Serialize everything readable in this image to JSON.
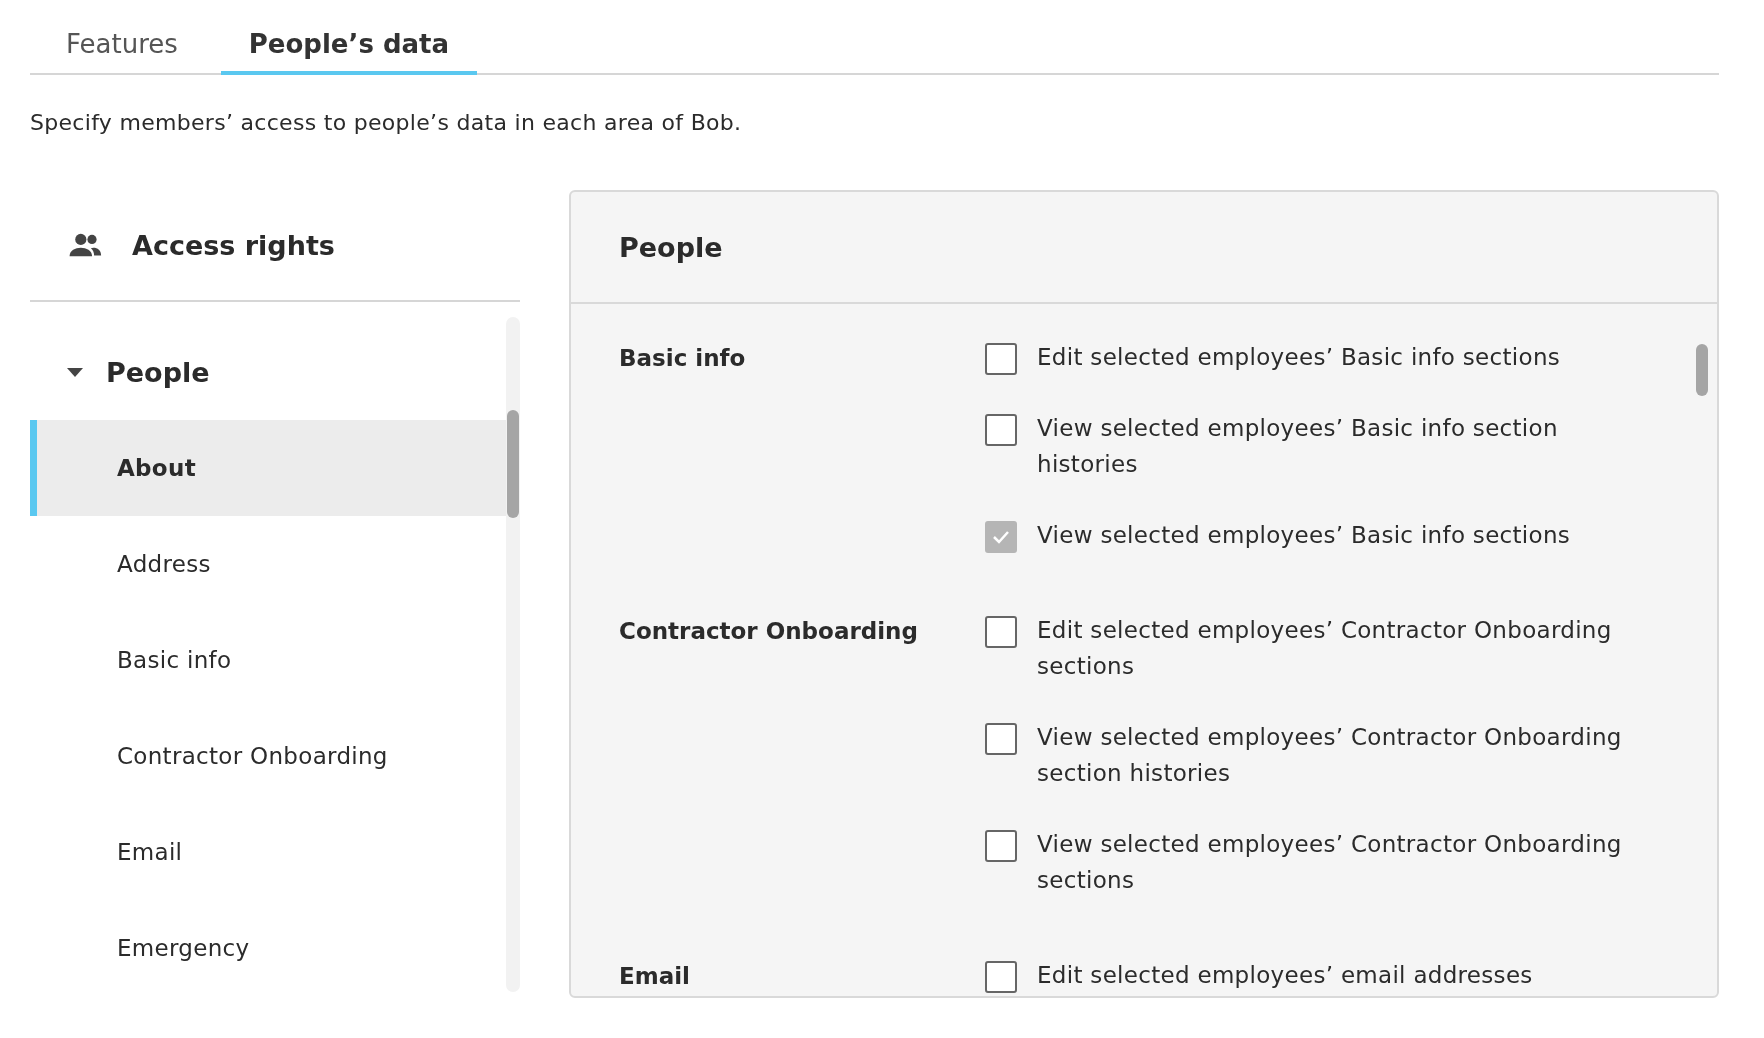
{
  "tabs": [
    {
      "label": "Features",
      "selected": false
    },
    {
      "label": "People’s data",
      "selected": true
    }
  ],
  "description": "Specify members’ access to people’s data in each area of Bob.",
  "sidebar": {
    "title": "Access rights",
    "section": {
      "label": "People",
      "expanded": true,
      "items": [
        {
          "label": "About",
          "selected": true
        },
        {
          "label": "Address",
          "selected": false
        },
        {
          "label": "Basic info",
          "selected": false
        },
        {
          "label": "Contractor Onboarding",
          "selected": false
        },
        {
          "label": "Email",
          "selected": false
        },
        {
          "label": "Emergency",
          "selected": false
        }
      ]
    }
  },
  "panel": {
    "title": "People",
    "groups": [
      {
        "label": "Basic info",
        "options": [
          {
            "label": "Edit selected employees’ Basic info sections",
            "checked": false
          },
          {
            "label": "View selected employees’ Basic info section histories",
            "checked": false
          },
          {
            "label": "View selected employees’ Basic info sections",
            "checked": true
          }
        ]
      },
      {
        "label": "Contractor Onboarding",
        "options": [
          {
            "label": "Edit selected employees’ Contractor Onboarding sections",
            "checked": false
          },
          {
            "label": "View selected employees’ Contractor Onboarding section histories",
            "checked": false
          },
          {
            "label": "View selected employees’ Contractor Onboarding sections",
            "checked": false
          }
        ]
      },
      {
        "label": "Email",
        "options": [
          {
            "label": "Edit selected employees’ email addresses",
            "checked": false
          }
        ]
      }
    ]
  }
}
